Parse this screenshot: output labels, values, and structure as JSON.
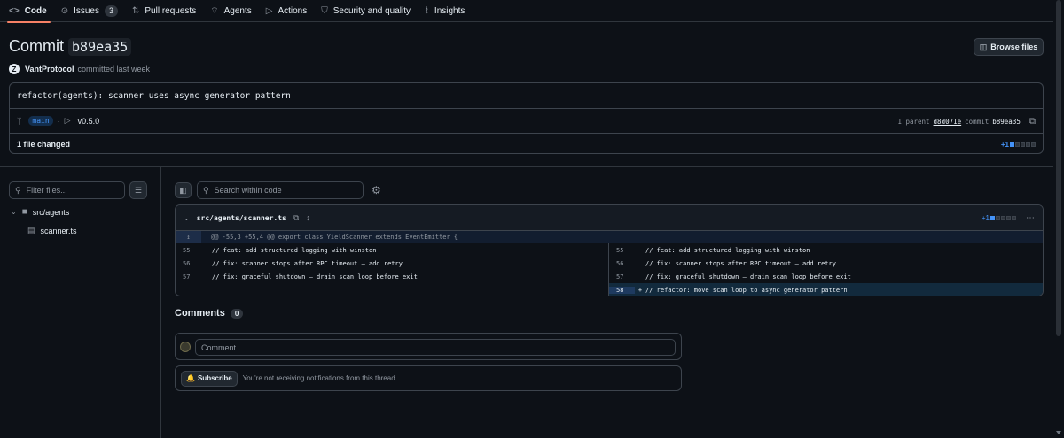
{
  "nav": {
    "items": [
      {
        "label": "Code",
        "icon": "code-icon",
        "glyph": "<>"
      },
      {
        "label": "Issues",
        "icon": "issue-icon",
        "glyph": "⊙",
        "count": "3"
      },
      {
        "label": "Pull requests",
        "icon": "pull-request-icon",
        "glyph": "⇅"
      },
      {
        "label": "Agents",
        "icon": "agents-icon",
        "glyph": "⌔"
      },
      {
        "label": "Actions",
        "icon": "play-icon",
        "glyph": "▷"
      },
      {
        "label": "Security and quality",
        "icon": "shield-icon",
        "glyph": "⛉"
      },
      {
        "label": "Insights",
        "icon": "graph-icon",
        "glyph": "⌇"
      }
    ]
  },
  "header": {
    "title_prefix": "Commit",
    "sha": "b89ea35",
    "browse_label": "Browse files",
    "author": "VantProtocol",
    "author_initial": "Z",
    "committed": "committed last week"
  },
  "commit": {
    "message": "refactor(agents): scanner uses async generator pattern",
    "branch": "main",
    "tag": "v0.5.0",
    "parent_count": "1 parent",
    "parent_sha": "d8d071e",
    "commit_label": "commit",
    "commit_sha": "b89ea35",
    "files_changed": "1 file changed",
    "additions": "+1"
  },
  "sidebar": {
    "filter_placeholder": "Filter files...",
    "folder": "src/agents",
    "file": "scanner.ts"
  },
  "toolbar": {
    "search_placeholder": "Search within code"
  },
  "diff": {
    "path": "src/agents/scanner.ts",
    "additions": "+1",
    "hunk": "@@ -55,3 +55,4 @@ export class YieldScanner extends EventEmitter {",
    "rows": [
      {
        "left_ln": "55",
        "left_code": "// feat: add structured logging with winston",
        "right_ln": "55",
        "right_sign": "",
        "right_code": "// feat: add structured logging with winston"
      },
      {
        "left_ln": "56",
        "left_code": "// fix: scanner stops after RPC timeout — add retry",
        "right_ln": "56",
        "right_sign": "",
        "right_code": "// fix: scanner stops after RPC timeout — add retry"
      },
      {
        "left_ln": "57",
        "left_code": "// fix: graceful shutdown — drain scan loop before exit",
        "right_ln": "57",
        "right_sign": "",
        "right_code": "// fix: graceful shutdown — drain scan loop before exit"
      },
      {
        "left_ln": "",
        "left_code": "",
        "right_ln": "58",
        "right_sign": "+",
        "right_code": "// refactor: move scan loop to async generator pattern"
      }
    ]
  },
  "comments": {
    "label": "Comments",
    "count": "0",
    "placeholder": "Comment",
    "subscribe_label": "Subscribe",
    "notice": "You're not receiving notifications from this thread."
  },
  "colors": {
    "accent": "#4493f8",
    "nav_underline": "#f78166",
    "background": "#0d1117"
  }
}
